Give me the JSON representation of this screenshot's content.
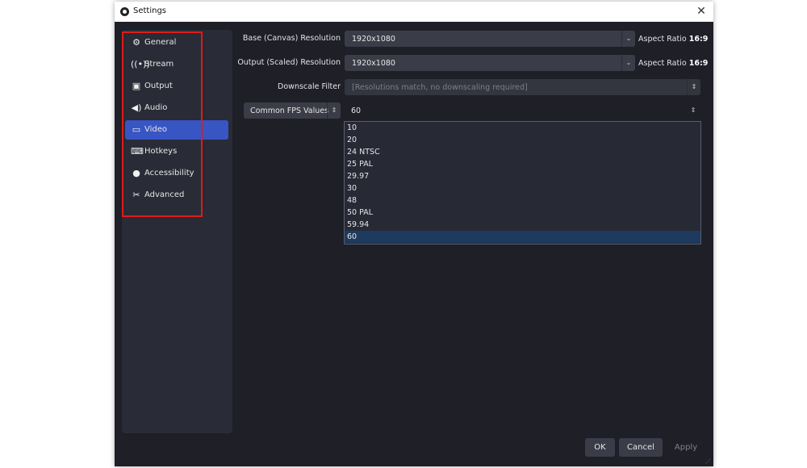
{
  "window": {
    "title": "Settings",
    "close_label": "✕"
  },
  "sidebar": {
    "items": [
      {
        "label": "General",
        "icon": "⚙",
        "icon_name": "gear-icon"
      },
      {
        "label": "Stream",
        "icon": "📡",
        "icon_name": "antenna-icon"
      },
      {
        "label": "Output",
        "icon": "▣",
        "icon_name": "output-icon"
      },
      {
        "label": "Audio",
        "icon": "🔊",
        "icon_name": "speaker-icon"
      },
      {
        "label": "Video",
        "icon": "▭",
        "icon_name": "monitor-icon",
        "active": true
      },
      {
        "label": "Hotkeys",
        "icon": "⌨",
        "icon_name": "keyboard-icon"
      },
      {
        "label": "Accessibility",
        "icon": "♿",
        "icon_name": "accessibility-icon"
      },
      {
        "label": "Advanced",
        "icon": "✂",
        "icon_name": "tools-icon"
      }
    ]
  },
  "video": {
    "base_resolution": {
      "label": "Base (Canvas) Resolution",
      "value": "1920x1080",
      "aspect_label": "Aspect Ratio",
      "aspect_value": "16:9"
    },
    "output_resolution": {
      "label": "Output (Scaled) Resolution",
      "value": "1920x1080",
      "aspect_label": "Aspect Ratio",
      "aspect_value": "16:9"
    },
    "downscale_filter": {
      "label": "Downscale Filter",
      "value": "[Resolutions match, no downscaling required]"
    },
    "fps": {
      "type_label": "Common FPS Values",
      "value": "60",
      "options": [
        "10",
        "20",
        "24 NTSC",
        "25 PAL",
        "29.97",
        "30",
        "48",
        "50 PAL",
        "59.94",
        "60"
      ],
      "selected": "60"
    }
  },
  "buttons": {
    "ok": "OK",
    "cancel": "Cancel",
    "apply": "Apply"
  },
  "colors": {
    "accent": "#3855c4",
    "highlight_box": "#e01b1b",
    "selected_option": "#1e3a5f"
  }
}
